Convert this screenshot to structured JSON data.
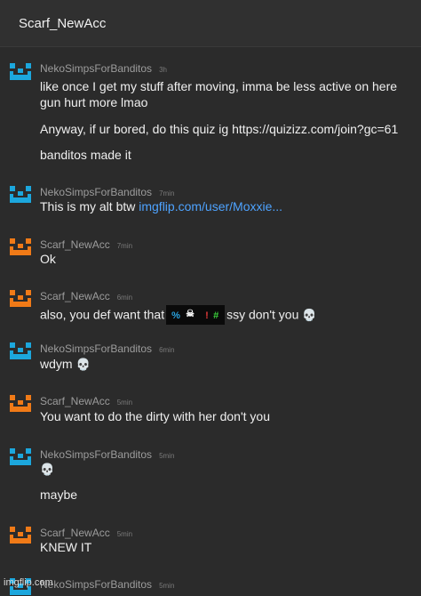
{
  "header": {
    "title": "Scarf_NewAcc"
  },
  "colors": {
    "blue_avatar": "#1ca7dd",
    "orange_avatar": "#f07a17",
    "link": "#4ea3ff"
  },
  "messages": [
    {
      "user": "NekoSimpsForBanditos",
      "time": "3h",
      "avatar": "blue",
      "lines": [
        "like once I get my stuff after moving, imma be less active on here",
        "gun hurt more lmao",
        "Anyway, if ur bored, do this quiz ig https://quizizz.com/join?gc=61",
        "banditos made it"
      ]
    },
    {
      "user": "NekoSimpsForBanditos",
      "time": "7min",
      "avatar": "blue",
      "text": "This is my alt btw",
      "link": "imgflip.com/user/Moxxie..."
    },
    {
      "user": "Scarf_NewAcc",
      "time": "7min",
      "avatar": "orange",
      "lines": [
        "Ok"
      ]
    },
    {
      "user": "Scarf_NewAcc",
      "time": "6min",
      "avatar": "orange",
      "before": "also, you def want that",
      "after": "ssy don't you",
      "emoji": "💀"
    },
    {
      "user": "NekoSimpsForBanditos",
      "time": "6min",
      "avatar": "blue",
      "text": "wdym",
      "emoji": "💀"
    },
    {
      "user": "Scarf_NewAcc",
      "time": "5min",
      "avatar": "orange",
      "lines": [
        "You want to do the dirty with her don't you"
      ]
    },
    {
      "user": "NekoSimpsForBanditos",
      "time": "5min",
      "avatar": "blue",
      "emoji": "💀",
      "lines": [
        "maybe"
      ]
    },
    {
      "user": "Scarf_NewAcc",
      "time": "5min",
      "avatar": "orange",
      "lines": [
        "KNEW IT"
      ]
    },
    {
      "user": "NekoSimpsForBanditos",
      "time": "5min",
      "avatar": "blue"
    }
  ],
  "watermark": "imgflip.com"
}
